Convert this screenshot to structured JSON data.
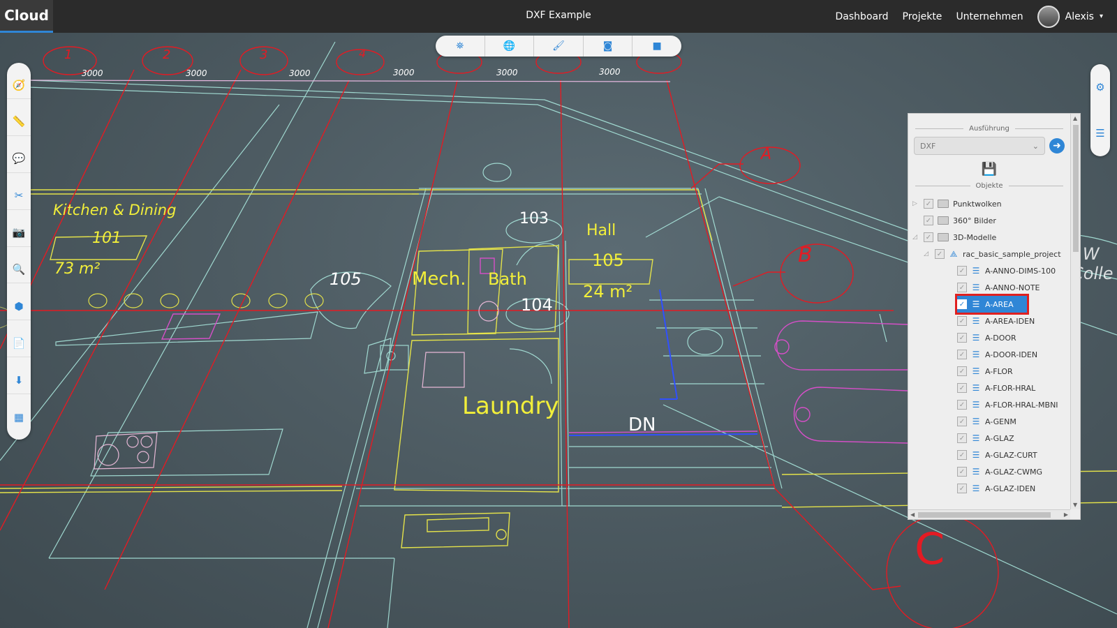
{
  "header": {
    "brand": "Cloud",
    "title": "DXF Example",
    "nav": [
      "Dashboard",
      "Projekte",
      "Unternehmen"
    ],
    "user": "Alexis"
  },
  "left_toolbar": [
    "compass-icon",
    "ruler-icon",
    "comment-icon",
    "scissors-icon",
    "camera-icon",
    "search-icon",
    "cube-icon",
    "file-add-icon",
    "download-icon",
    "grid-icon"
  ],
  "top_toolbar": [
    "binoculars-icon",
    "globe-icon",
    "brush-icon",
    "vr-glasses-icon",
    "square-icon"
  ],
  "right_toolbar": [
    "settings-icon",
    "layers-icon"
  ],
  "panel": {
    "section_ausfuehrung": "Ausführung",
    "select_value": "DXF",
    "section_objekte": "Objekte",
    "tree": [
      {
        "label": "Punktwolken",
        "type": "folder"
      },
      {
        "label": "360° Bilder",
        "type": "folder"
      },
      {
        "label": "3D-Modelle",
        "type": "folder"
      },
      {
        "label": "rac_basic_sample_project",
        "type": "model"
      },
      {
        "label": "A-ANNO-DIMS-100",
        "type": "layer"
      },
      {
        "label": "A-ANNO-NOTE",
        "type": "layer"
      },
      {
        "label": "A-AREA",
        "type": "layer",
        "selected": true
      },
      {
        "label": "A-AREA-IDEN",
        "type": "layer"
      },
      {
        "label": "A-DOOR",
        "type": "layer"
      },
      {
        "label": "A-DOOR-IDEN",
        "type": "layer"
      },
      {
        "label": "A-FLOR",
        "type": "layer"
      },
      {
        "label": "A-FLOR-HRAL",
        "type": "layer"
      },
      {
        "label": "A-FLOR-HRAL-MBNI",
        "type": "layer"
      },
      {
        "label": "A-GENM",
        "type": "layer"
      },
      {
        "label": "A-GLAZ",
        "type": "layer"
      },
      {
        "label": "A-GLAZ-CURT",
        "type": "layer"
      },
      {
        "label": "A-GLAZ-CWMG",
        "type": "layer"
      },
      {
        "label": "A-GLAZ-IDEN",
        "type": "layer"
      }
    ]
  },
  "drawing": {
    "grid_numbers": [
      "1",
      "2",
      "3",
      "4"
    ],
    "grid_letters": [
      "A",
      "B",
      "C"
    ],
    "dims": [
      "3000",
      "3000",
      "3000",
      "3000",
      "3000",
      "3000"
    ],
    "room_kitchen": "Kitchen & Dining",
    "room_kitchen_num": "101",
    "room_kitchen_area": "73 m²",
    "num_105a": "105",
    "room_mech": "Mech.",
    "room_bath": "Bath",
    "num_103": "103",
    "num_104": "104",
    "room_hall": "Hall",
    "num_105b": "105",
    "area_24": "24 m²",
    "room_laundry": "Laundry",
    "label_dn": "DN",
    "label_rain": "Rain W",
    "label_colle": "Colle"
  },
  "colors": {
    "accent": "#2f86d6",
    "highlight_border": "#e02020"
  }
}
